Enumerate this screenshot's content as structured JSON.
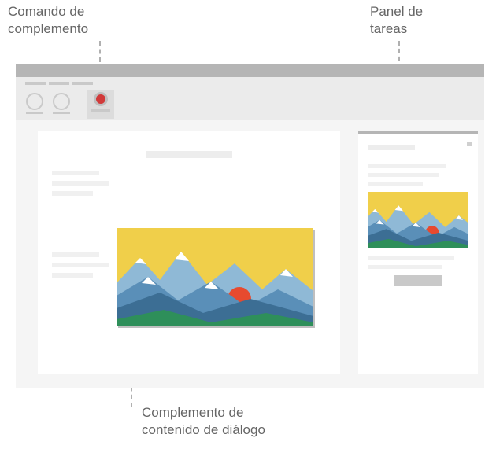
{
  "labels": {
    "addin_command": "Comando de\ncomplemento",
    "task_pane": "Panel de\ntareas",
    "content_dialog": "Complemento de\ncontenido de diálogo"
  },
  "illustration": {
    "colors": {
      "sky": "#f0cf4a",
      "mountain_back": "#8fb9d6",
      "mountain_mid": "#5a8fb8",
      "mountain_front": "#3c6e94",
      "hills": "#2e8f5a",
      "sun": "#e74a2f",
      "snow": "#ffffff"
    }
  }
}
